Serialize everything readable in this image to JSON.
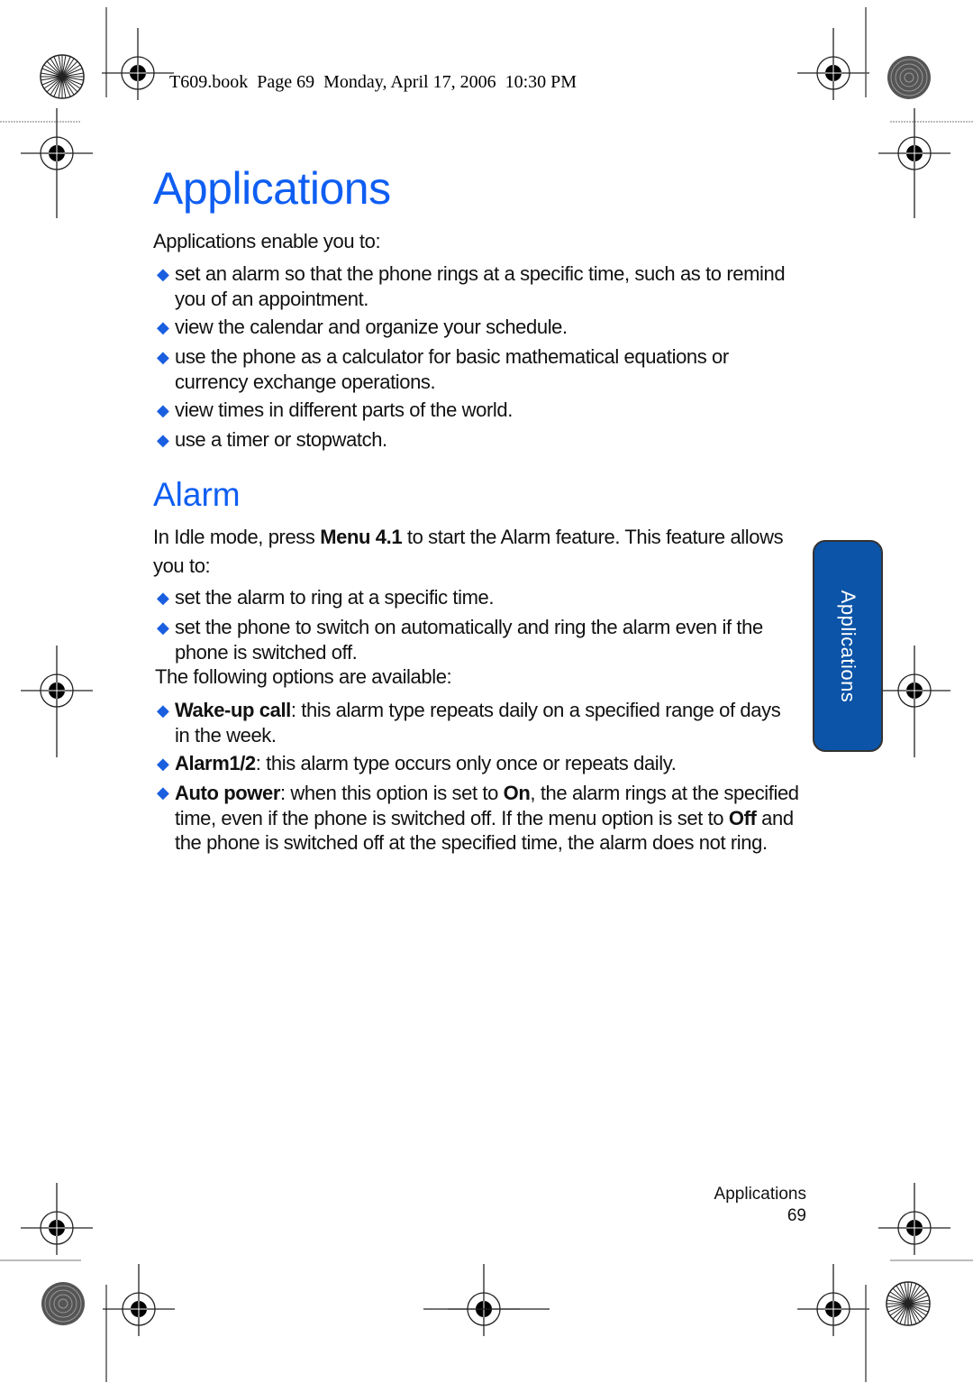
{
  "header": {
    "print_info": "T609.book  Page 69  Monday, April 17, 2006  10:30 PM"
  },
  "title": "Applications",
  "intro": "Applications enable you to:",
  "intro_bullets": [
    "set an alarm so that the phone rings at a specific time, such as to remind you of an appointment.",
    "view the calendar and organize your schedule.",
    "use the phone as a calculator for basic mathematical equations or currency exchange operations.",
    "view times in different parts of the world.",
    "use a timer or stopwatch."
  ],
  "alarm": {
    "heading": "Alarm",
    "para_prefix": "In Idle mode, press ",
    "para_menu": "Menu 4.1",
    "para_suffix": " to start the Alarm feature. This feature allows you to:",
    "bullets": [
      "set the alarm to ring at a specific time.",
      "set the phone to switch on automatically and ring the alarm even if the phone is switched off."
    ],
    "options_intro": "The following options are available:",
    "options": [
      {
        "term": "Wake-up call",
        "text": ": this alarm type repeats daily on a specified range of days in the week."
      },
      {
        "term": "Alarm1/2",
        "text": ": this alarm type occurs only once or repeats daily."
      },
      {
        "term": "Auto power",
        "text_1": ": when this option is set to ",
        "on": "On",
        "text_2": ", the alarm rings at the specified time, even if the phone is switched off. If the menu option is set to ",
        "off": "Off",
        "text_3": " and the phone is switched off at the specified time, the alarm does not ring."
      }
    ]
  },
  "side_tab": {
    "label": "Applications"
  },
  "footer": {
    "section": "Applications",
    "page_number": "69"
  },
  "colors": {
    "heading": "#0f5ef2",
    "bullet": "#1a5fe0",
    "tab": "#0b54a8"
  },
  "icons": {
    "bullet": "diamond-bullet-icon",
    "registration": "registration-mark-icon",
    "color_bar": "starburst-target-icon"
  }
}
